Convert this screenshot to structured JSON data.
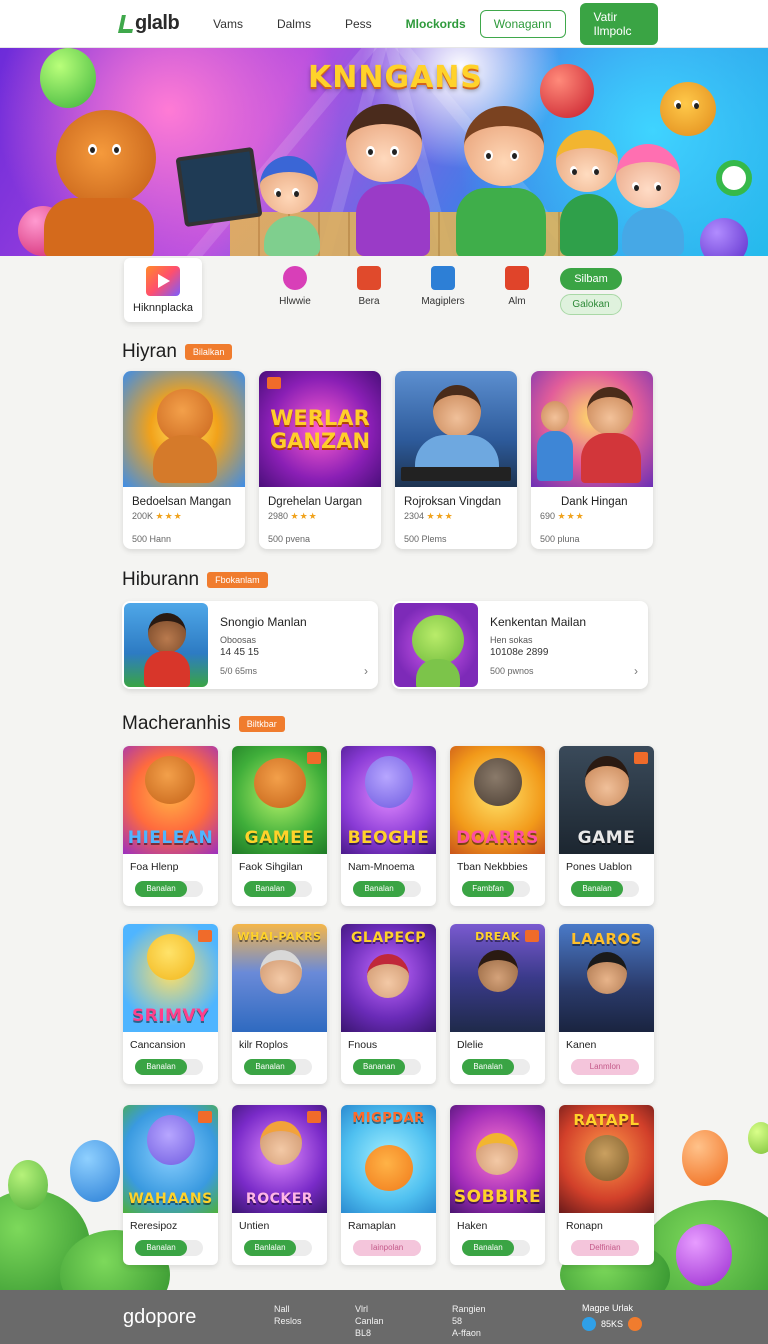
{
  "header": {
    "logo": "glalb",
    "nav": [
      "Vams",
      "Dalms",
      "Pess",
      "Mlockords"
    ],
    "outline_button": "Wonagann",
    "solid_button": "Vatir Ilmpolc"
  },
  "hero": {
    "title": "KNNGANS"
  },
  "categories": {
    "main_label": "Hiknnplacka",
    "items": [
      {
        "label": "Hlwwie",
        "icon": "pink-circle-icon",
        "color": "#d83fb8"
      },
      {
        "label": "Bera",
        "icon": "cube-icon",
        "color": "#e04a2c"
      },
      {
        "label": "Magiplers",
        "icon": "play-cube-icon",
        "color": "#2d7fd6"
      },
      {
        "label": "Alm",
        "icon": "red-box-icon",
        "color": "#e0442a"
      }
    ],
    "pill_primary": "Silbam",
    "pill_secondary": "Galokan"
  },
  "sections": {
    "featured": {
      "title": "Hiyran",
      "tag": "Bilalkan"
    },
    "wide": {
      "title": "Hiburann",
      "tag": "Fbokanlam"
    },
    "grid": {
      "title": "Macheranhis",
      "tag": "Biltkbar"
    }
  },
  "featured_cards": [
    {
      "name": "Bedoelsan Mangan",
      "rating": "200K",
      "stars": "★★★",
      "count": "500 Hann"
    },
    {
      "name": "Dgrehelan Uargan",
      "rating": "2980",
      "stars": "★★★",
      "count": "500 pvena"
    },
    {
      "name": "Rojroksan Vingdan",
      "rating": "2304",
      "stars": "★★★",
      "count": "500 Plems"
    },
    {
      "name": "Dank Hingan",
      "rating": "690",
      "stars": "★★★",
      "count": "500 pluna"
    }
  ],
  "wide_cards": [
    {
      "name": "Snongio Manlan",
      "sub": "Oboosas",
      "num": "14 45 15",
      "count": "5/0 65ms",
      "arrow": "›"
    },
    {
      "name": "Kenkentan Mailan",
      "sub": "Hen sokas",
      "num": "10108e 2899",
      "count": "500 pwnos",
      "arrow": "›"
    }
  ],
  "grid_cards": [
    [
      {
        "name": "Foa Hlenp",
        "button": "Banalan",
        "cover": "HIELEAN"
      },
      {
        "name": "Faok Sihgilan",
        "button": "Banalan",
        "cover": "GAMEE"
      },
      {
        "name": "Nam-Mnoema",
        "button": "Banalan",
        "cover": "BEOGHE"
      },
      {
        "name": "Tban Nekbbies",
        "button": "Fambfan",
        "cover": "DOARRS"
      },
      {
        "name": "Pones Uablon",
        "button": "Banalan",
        "cover": "GAME"
      }
    ],
    [
      {
        "name": "Cancansion",
        "button": "Banalan",
        "cover": "SRIMVY"
      },
      {
        "name": "kilr Roplos",
        "button": "Banalan",
        "cover": "WHAI-PAKRS"
      },
      {
        "name": "Fnous",
        "button": "Bananan",
        "cover": "GLAPECP"
      },
      {
        "name": "Dlelie",
        "button": "Banalan",
        "cover": "DREAK"
      },
      {
        "name": "Kanen",
        "button": "Lanmlon",
        "cover": "LAAROS",
        "pink": true
      }
    ],
    [
      {
        "name": "Reresipoz",
        "button": "Banalan",
        "cover": "WAHAANS"
      },
      {
        "name": "Untien",
        "button": "Banlalan",
        "cover": "ROCKER"
      },
      {
        "name": "Ramaplan",
        "button": "Iainpolan",
        "cover": "MIGPDAR",
        "pink": true
      },
      {
        "name": "Haken",
        "button": "Banalan",
        "cover": "SOBBIRE"
      },
      {
        "name": "Ronapn",
        "button": "Delfinian",
        "cover": "RATAPL",
        "pink": true
      }
    ]
  ],
  "footer": {
    "logo": "gdopore",
    "col1": [
      "Nall",
      "Reslos"
    ],
    "col2": [
      "Vlrl",
      "Canlan",
      "BL8"
    ],
    "col3": [
      "Rangien",
      "58",
      "A-ffaon"
    ],
    "social_title": "Magpe Urlak",
    "social_text": "85KS"
  }
}
